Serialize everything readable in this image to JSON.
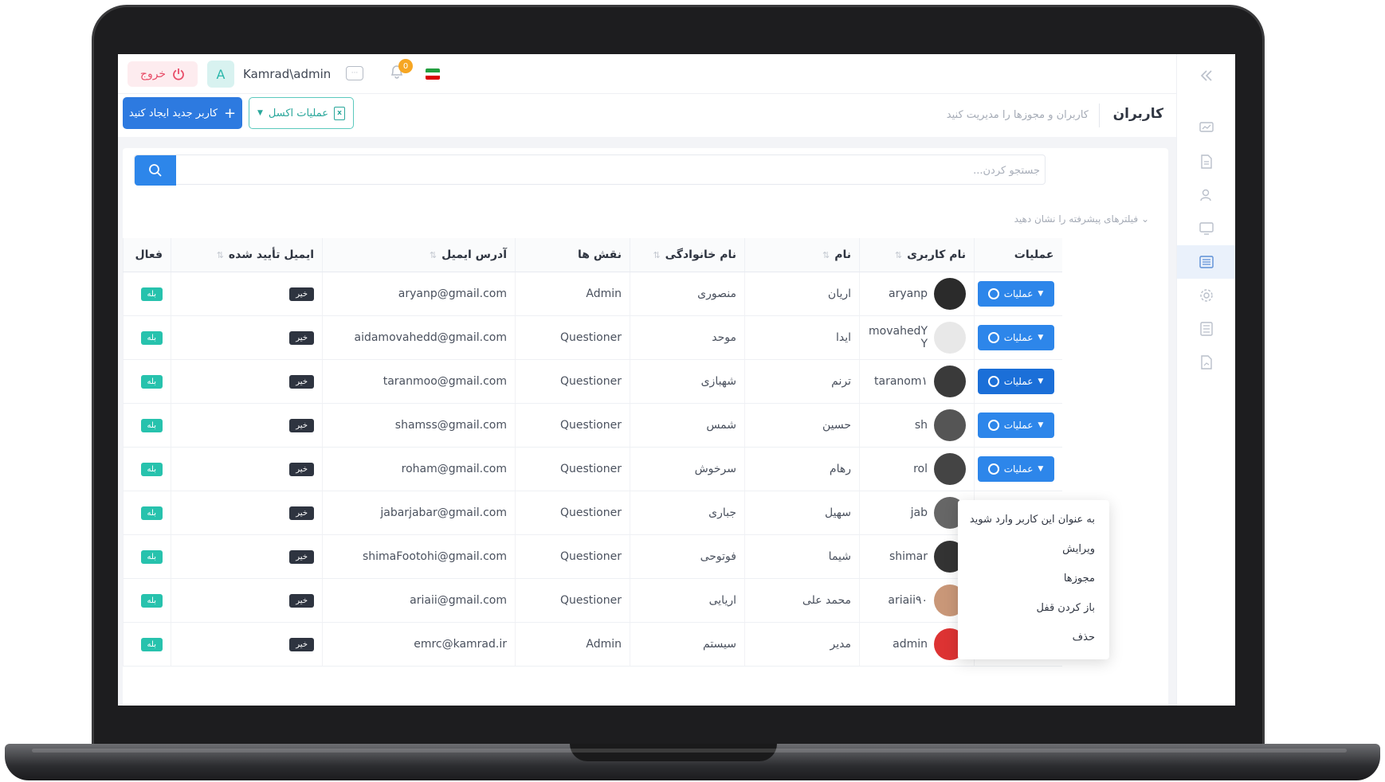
{
  "topbar": {
    "logout_label": "خروج",
    "avatar_letter": "A",
    "username": "Kamrad\\admin",
    "chat_glyph": "···",
    "notification_count": "0"
  },
  "header": {
    "title": "کاربران",
    "subtitle": "کاربران و مجوزها را مدیریت کنید",
    "new_user_label": "کاربر جدید ایجاد کنید",
    "excel_label": "عملیات اکسل"
  },
  "search": {
    "placeholder": "جستجو کردن..."
  },
  "advanced_filter_label": "فیلترهای پیشرفته را نشان دهید",
  "table": {
    "headers": {
      "operations": "عملیات",
      "username": "نام کاربری",
      "first_name": "نام",
      "last_name": "نام خانوادگی",
      "roles": "نقش ها",
      "email": "آدرس ایمیل",
      "email_confirmed": "ایمیل تأیید شده",
      "active": "فعال"
    },
    "ops_label": "عملیات",
    "rows": [
      {
        "username": "aryanp",
        "first_name": "اریان",
        "last_name": "منصوری",
        "role": "Admin",
        "email": "aryanp@gmail.com",
        "email_confirmed": "خیر",
        "active": "بله"
      },
      {
        "username": "movahedY Y",
        "first_name": "ایدا",
        "last_name": "موحد",
        "role": "Questioner",
        "email": "aidamovahedd@gmail.com",
        "email_confirmed": "خیر",
        "active": "بله"
      },
      {
        "username": "taranom١",
        "first_name": "ترنم",
        "last_name": "شهبازی",
        "role": "Questioner",
        "email": "taranmoo@gmail.com",
        "email_confirmed": "خیر",
        "active": "بله"
      },
      {
        "username": "sh",
        "first_name": "حسین",
        "last_name": "شمس",
        "role": "Questioner",
        "email": "shamss@gmail.com",
        "email_confirmed": "خیر",
        "active": "بله"
      },
      {
        "username": "rol",
        "first_name": "رهام",
        "last_name": "سرخوش",
        "role": "Questioner",
        "email": "roham@gmail.com",
        "email_confirmed": "خیر",
        "active": "بله"
      },
      {
        "username": "jab",
        "first_name": "سهیل",
        "last_name": "جباری",
        "role": "Questioner",
        "email": "jabarjabar@gmail.com",
        "email_confirmed": "خیر",
        "active": "بله"
      },
      {
        "username": "shimar",
        "first_name": "شیما",
        "last_name": "فوتوحی",
        "role": "Questioner",
        "email": "shimaFootohi@gmail.com",
        "email_confirmed": "خیر",
        "active": "بله"
      },
      {
        "username": "ariaii٩٠",
        "first_name": "محمد علی",
        "last_name": "اریایی",
        "role": "Questioner",
        "email": "ariaii@gmail.com",
        "email_confirmed": "خیر",
        "active": "بله"
      },
      {
        "username": "admin",
        "first_name": "مدیر",
        "last_name": "سیستم",
        "role": "Admin",
        "email": "emrc@kamrad.ir",
        "email_confirmed": "خیر",
        "active": "بله"
      }
    ]
  },
  "dropdown": {
    "items": [
      "به عنوان این کاربر وارد شوید",
      "ویرایش",
      "مجوزها",
      "باز کردن قفل",
      "حذف"
    ]
  },
  "colors": {
    "primary": "#2d86ea",
    "success": "#27c2ad",
    "danger": "#e84d68",
    "dark": "#2e3440"
  }
}
